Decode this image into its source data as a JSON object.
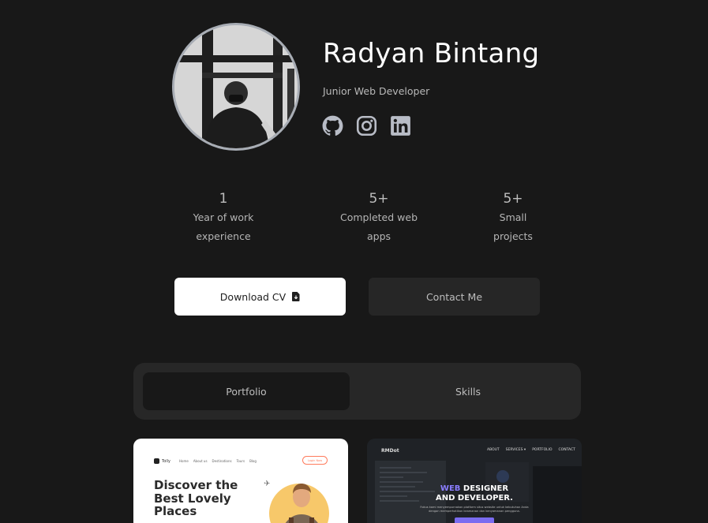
{
  "profile": {
    "name": "Radyan Bintang",
    "role": "Junior Web Developer"
  },
  "socials": [
    {
      "icon": "github-icon"
    },
    {
      "icon": "instagram-icon"
    },
    {
      "icon": "linkedin-icon"
    }
  ],
  "stats": [
    {
      "value": "1",
      "label_line1": "Year of work",
      "label_line2": "experience"
    },
    {
      "value": "5+",
      "label_line1": "Completed web",
      "label_line2": "apps"
    },
    {
      "value": "5+",
      "label_line1": "Small",
      "label_line2": "projects"
    }
  ],
  "actions": {
    "download_label": "Download CV",
    "download_icon": "file-download-icon",
    "contact_label": "Contact Me"
  },
  "tabs": [
    {
      "label": "Portfolio",
      "active": true
    },
    {
      "label": "Skills",
      "active": false
    }
  ],
  "portfolio": {
    "card1": {
      "logo": "Tolly",
      "nav": [
        "Home",
        "About us",
        "Destinations",
        "Tours",
        "Blog"
      ],
      "button": "Login Now",
      "headline": "Discover the Best Lovely Places"
    },
    "card2": {
      "logo": "RMDot",
      "nav": [
        "ABOUT",
        "SERVICES ▾",
        "PORTFOLIO",
        "CONTACT"
      ],
      "title_accent": "WEB",
      "title_rest": " DESIGNER",
      "title_line2": "AND DEVELOPER.",
      "subtitle": "Fokus kami menyempurnakan platform situs website untuk kebutuhan Anda dengan memperhatikan keamanan dan kenyamanan pengguna."
    }
  },
  "colors": {
    "background": "#181818",
    "surface": "#272727",
    "accent": "#8a7dff"
  }
}
